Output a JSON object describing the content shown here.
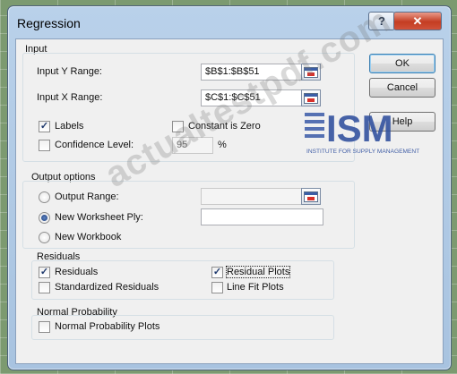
{
  "window": {
    "title": "Regression",
    "help_glyph": "?",
    "close_glyph": "✕"
  },
  "input": {
    "group_label": "Input",
    "y_range_label": "Input Y Range:",
    "y_range_value": "$B$1:$B$51",
    "x_range_label": "Input X Range:",
    "x_range_value": "$C$1:$C$51",
    "labels": {
      "label": "Labels",
      "checked": true
    },
    "constant_is_zero": {
      "label": "Constant is Zero",
      "checked": false
    },
    "confidence_level": {
      "label": "Confidence Level:",
      "checked": false,
      "value": "95",
      "unit": "%"
    }
  },
  "buttons": {
    "ok": "OK",
    "cancel": "Cancel",
    "help": "Help"
  },
  "output": {
    "group_label": "Output options",
    "output_range": {
      "label": "Output Range:",
      "selected": false,
      "value": ""
    },
    "new_worksheet_ply": {
      "label": "New Worksheet Ply:",
      "selected": true,
      "value": ""
    },
    "new_workbook": {
      "label": "New Workbook",
      "selected": false
    }
  },
  "residuals": {
    "group_label": "Residuals",
    "residuals": {
      "label": "Residuals",
      "checked": true
    },
    "standardized_residuals": {
      "label": "Standardized Residuals",
      "checked": false
    },
    "residual_plots": {
      "label": "Residual Plots",
      "checked": true
    },
    "line_fit_plots": {
      "label": "Line Fit Plots",
      "checked": false
    }
  },
  "normal_probability": {
    "group_label": "Normal Probability",
    "normal_probability_plots": {
      "label": "Normal Probability Plots",
      "checked": false
    }
  },
  "overlay": {
    "watermark": "actualtestpdf.com",
    "logo_text": "ISM",
    "logo_subtext": "INSTITUTE FOR SUPPLY MANAGEMENT"
  },
  "icons": {
    "range_selector": "range-selector-icon",
    "check": "check-icon"
  },
  "colors": {
    "frame": "#b9d1ea",
    "client": "#f0f0f0",
    "close": "#c43d22",
    "logo_blue": "#2f4f9e"
  }
}
